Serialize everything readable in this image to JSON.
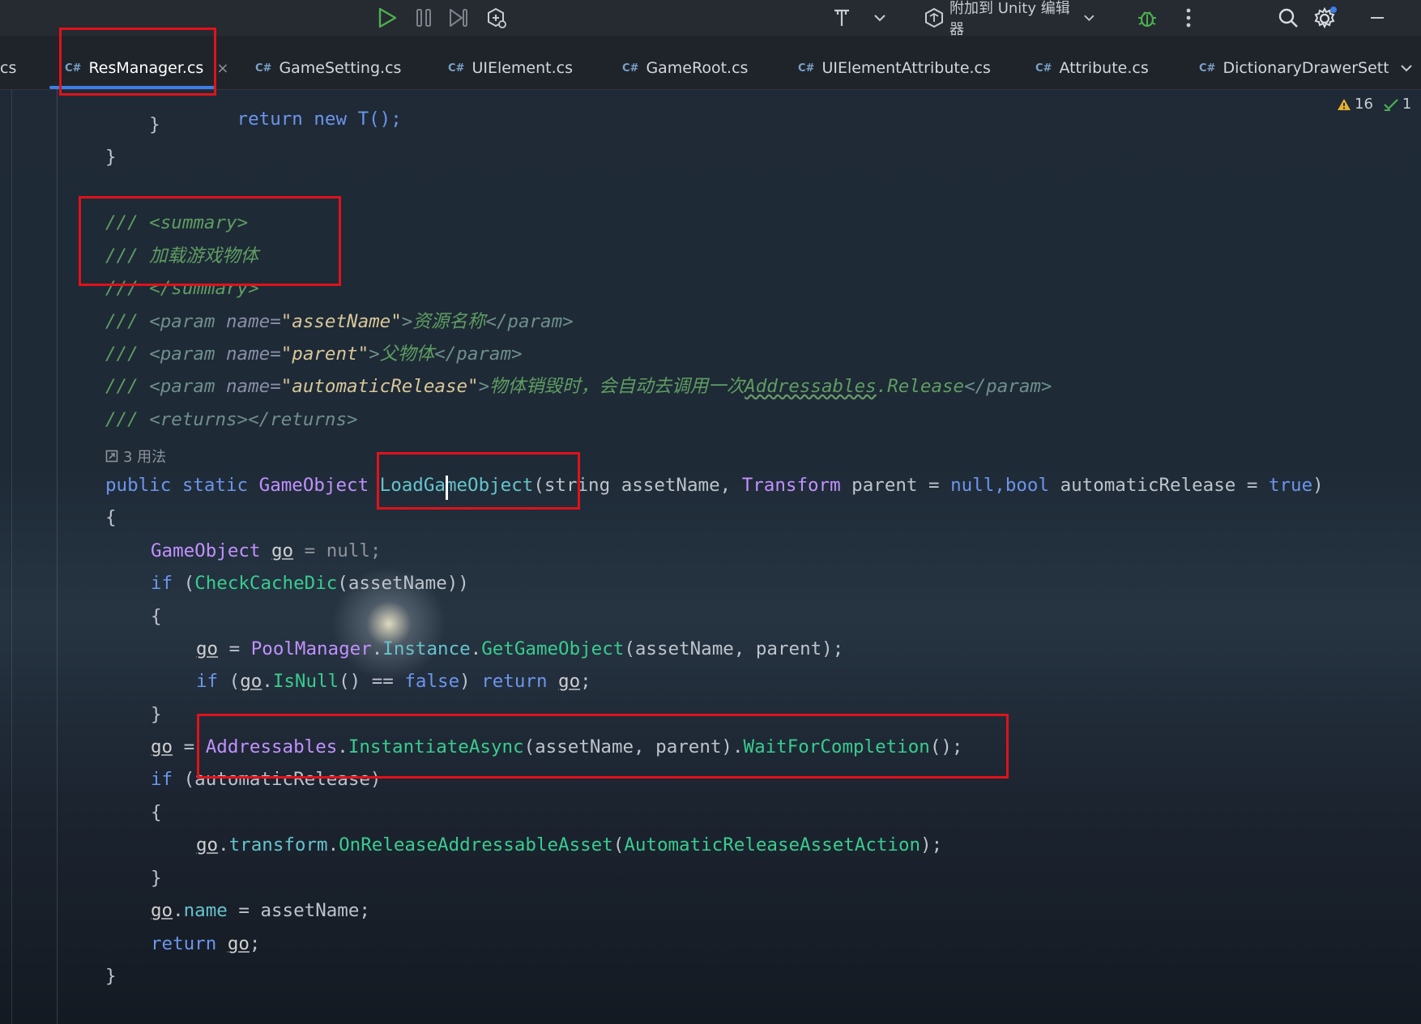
{
  "toolbar": {
    "attach_label": "附加到 Unity 编辑器",
    "icons": [
      "run-icon",
      "pause-icon",
      "step-icon",
      "debug-attach-icon",
      "build-icon",
      "chevron-down-icon",
      "unity-icon",
      "bug-icon",
      "more-icon",
      "search-icon",
      "settings-icon",
      "minimize-icon"
    ]
  },
  "tabs": [
    {
      "label": "cs",
      "lang": ""
    },
    {
      "label": "ResManager.cs",
      "lang": "C#",
      "active": true
    },
    {
      "label": "GameSetting.cs",
      "lang": "C#"
    },
    {
      "label": "UIElement.cs",
      "lang": "C#"
    },
    {
      "label": "GameRoot.cs",
      "lang": "C#"
    },
    {
      "label": "UIElementAttribute.cs",
      "lang": "C#"
    },
    {
      "label": "Attribute.cs",
      "lang": "C#"
    },
    {
      "label": "DictionaryDrawerSetti",
      "lang": "C#"
    }
  ],
  "inspections": {
    "warnings": "16",
    "ok": "1"
  },
  "usages": "3 用法",
  "code": {
    "l0": "        return new T();",
    "l1_close": "    }",
    "l2_close": "}",
    "doc_summary_open": "/// <summary>",
    "doc_summary_text": "/// 加载游戏物体",
    "doc_summary_close": "/// </summary>",
    "p1_name": "\"assetName\"",
    "p1_text": "资源名称",
    "p2_name": "\"parent\"",
    "p2_text": "父物体",
    "p3_name": "\"automaticRelease\"",
    "p3_text": "物体销毁时，会自动去调用一次",
    "p3_link": "Addressables",
    "p3_tail": ".Release",
    "returns": "<returns></returns>",
    "sig_public": "public static ",
    "sig_type": "GameObject ",
    "sig_name": "LoadGameObject",
    "sig_p1": "(string assetName, ",
    "sig_p2_type": "Transform",
    "sig_p2": " parent = ",
    "sig_null": "null",
    "sig_bool": ",bool",
    "sig_p3": " automaticRelease = ",
    "sig_true": "true",
    "sig_close": ")",
    "brace_open": "{",
    "brace_close": "}",
    "go_decl_type": "GameObject ",
    "go_decl_var": "go",
    "go_decl_rest": " = null;",
    "if1_kw": "if",
    "if1_fn": "CheckCacheDic",
    "if1_rest": "(assetName))",
    "pool_var": "go",
    "pool_eq": " = ",
    "pool_cls": "PoolManager",
    "pool_inst": "Instance",
    "pool_fn": "GetGameObject",
    "pool_rest": "(assetName, parent);",
    "ifnull_kw": "if",
    "ifnull_var": "go",
    "ifnull_fn": "IsNull",
    "ifnull_false": "false",
    "ifnull_ret": "return",
    "ifnull_go": "go",
    "addr_var": "go",
    "addr_cls": "Addressables",
    "addr_fn": "InstantiateAsync",
    "addr_mid": "(assetName, parent).",
    "addr_fn2": "WaitForCompletion",
    "addr_end": "();",
    "if2_kw": "if",
    "if2_rest": " (automaticRelease)",
    "rel_var": "go",
    "rel_tr": "transform",
    "rel_fn": "OnReleaseAddressableAsset",
    "rel_arg": "AutomaticReleaseAssetAction",
    "rel_end": ");",
    "name_var": "go",
    "name_prop": "name",
    "name_rest": " = assetName;",
    "ret_kw": "return",
    "ret_var": "go"
  },
  "colors": {
    "highlight_box": "#e0121a",
    "active_tab_underline": "#3d7ee6"
  }
}
